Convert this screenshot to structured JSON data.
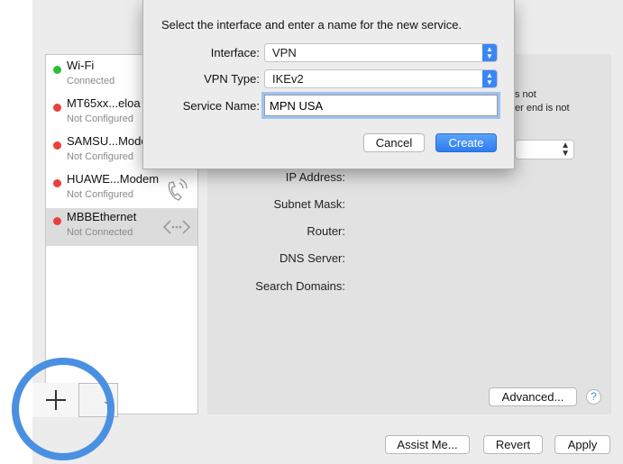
{
  "sheet": {
    "prompt": "Select the interface and enter a name for the new service.",
    "interface_label": "Interface:",
    "interface_value": "VPN",
    "vpn_type_label": "VPN Type:",
    "vpn_type_value": "IKEv2",
    "service_name_label": "Service Name:",
    "service_name_value": "MPN USA",
    "cancel_label": "Cancel",
    "create_label": "Create"
  },
  "services": [
    {
      "name": "Wi-Fi",
      "status": "Connected",
      "dot_color": "#2dbd3a",
      "icon": "none"
    },
    {
      "name": "MT65xx...eloa",
      "status": "Not Configured",
      "dot_color": "#e8413c",
      "icon": "none"
    },
    {
      "name": "SAMSU...Mode",
      "status": "Not Configured",
      "dot_color": "#e8413c",
      "icon": "none"
    },
    {
      "name": "HUAWE...Modem",
      "status": "Not Configured",
      "dot_color": "#e8413c",
      "icon": "phone-icon"
    },
    {
      "name": "MBBEthernet",
      "status": "Not Connected",
      "dot_color": "#e8413c",
      "icon": "ethernet-icon"
    }
  ],
  "detail": {
    "status_fragment_1": "s not",
    "status_fragment_2": "er end is not",
    "ip_address_label": "IP Address:",
    "subnet_mask_label": "Subnet Mask:",
    "router_label": "Router:",
    "dns_server_label": "DNS Server:",
    "search_domains_label": "Search Domains:",
    "advanced_label": "Advanced...",
    "help_label": "?"
  },
  "footer": {
    "assist_label": "Assist Me...",
    "revert_label": "Revert",
    "apply_label": "Apply"
  },
  "list_controls": {
    "add_icon": "plus-icon",
    "action_chevron": "chevron-down-icon"
  },
  "colors": {
    "accent": "#3b86f7",
    "highlight_ring": "#4a90e2",
    "status_connected": "#2dbd3a",
    "status_disconnected": "#e8413c"
  }
}
